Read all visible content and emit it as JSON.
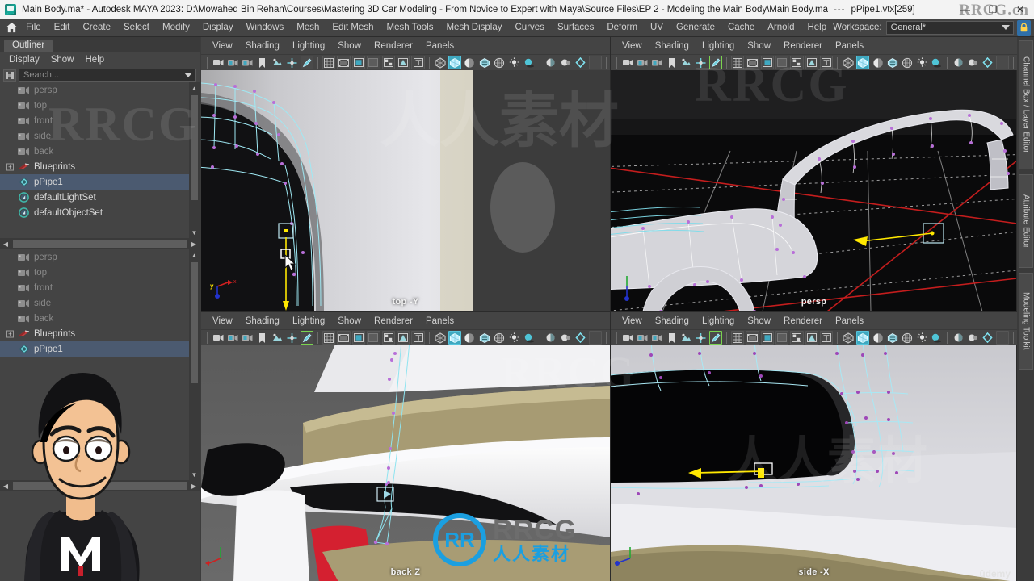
{
  "titlebar": {
    "app_icon": "maya-file-icon",
    "title": "Main Body.ma* - Autodesk MAYA 2023: D:\\Mowahed Bin Rehan\\Courses\\Mastering 3D Car Modeling - From Novice to Expert with Maya\\Source Files\\EP 2 - Modeling the Main Body\\Main Body.ma",
    "separator": "---",
    "selection": "pPipe1.vtx[259]",
    "minimize": "—",
    "maximize": "❐",
    "close": "✕"
  },
  "menubar": {
    "home_icon": "home-icon",
    "items": [
      "File",
      "Edit",
      "Create",
      "Select",
      "Modify",
      "Display",
      "Windows",
      "Mesh",
      "Edit Mesh",
      "Mesh Tools",
      "Mesh Display",
      "Curves",
      "Surfaces",
      "Deform",
      "UV",
      "Generate",
      "Cache",
      "Arnold",
      "Help"
    ],
    "workspace_label": "Workspace:",
    "workspace_value": "General*",
    "lock_icon": "lock-icon"
  },
  "outliner": {
    "tab_label": "Outliner",
    "menus": [
      "Display",
      "Show",
      "Help"
    ],
    "search_icon": "outliner-filter-icon",
    "search_placeholder": "Search...",
    "top_items": [
      {
        "label": "persp",
        "icon": "camera-icon",
        "dim": true,
        "selected": false,
        "expandable": false
      },
      {
        "label": "top",
        "icon": "camera-icon",
        "dim": true,
        "selected": false,
        "expandable": false
      },
      {
        "label": "front",
        "icon": "camera-icon",
        "dim": true,
        "selected": false,
        "expandable": false
      },
      {
        "label": "side",
        "icon": "camera-icon",
        "dim": true,
        "selected": false,
        "expandable": false
      },
      {
        "label": "back",
        "icon": "camera-icon",
        "dim": true,
        "selected": false,
        "expandable": false
      },
      {
        "label": "Blueprints",
        "icon": "group-icon",
        "dim": false,
        "selected": false,
        "expandable": true
      },
      {
        "label": "pPipe1",
        "icon": "mesh-icon",
        "dim": false,
        "selected": true,
        "expandable": false
      },
      {
        "label": "defaultLightSet",
        "icon": "set-icon",
        "dim": false,
        "selected": false,
        "expandable": false
      },
      {
        "label": "defaultObjectSet",
        "icon": "set-icon",
        "dim": false,
        "selected": false,
        "expandable": false
      }
    ],
    "bottom_items": [
      {
        "label": "persp",
        "icon": "camera-icon",
        "dim": true,
        "selected": false,
        "expandable": false
      },
      {
        "label": "top",
        "icon": "camera-icon",
        "dim": true,
        "selected": false,
        "expandable": false
      },
      {
        "label": "front",
        "icon": "camera-icon",
        "dim": true,
        "selected": false,
        "expandable": false
      },
      {
        "label": "side",
        "icon": "camera-icon",
        "dim": true,
        "selected": false,
        "expandable": false
      },
      {
        "label": "back",
        "icon": "camera-icon",
        "dim": true,
        "selected": false,
        "expandable": false
      },
      {
        "label": "Blueprints",
        "icon": "group-icon",
        "dim": false,
        "selected": false,
        "expandable": true
      },
      {
        "label": "pPipe1",
        "icon": "mesh-icon",
        "dim": false,
        "selected": true,
        "expandable": false
      }
    ]
  },
  "viewport_menus": [
    "View",
    "Shading",
    "Lighting",
    "Show",
    "Renderer",
    "Panels"
  ],
  "viewport_toolbar_icons": [
    "select-camera-icon",
    "camera-attributes-icon",
    "bookmarks-icon",
    "image-plane-icon",
    "paint-effects-icon",
    "snap-icon",
    "toggle-gizmo-icon",
    "grid-icon",
    "film-gate-icon",
    "resolution-gate-icon",
    "gate-mask-icon",
    "exposure-icon",
    "xray-icon",
    "xray-joints-icon",
    "wireframe-icon",
    "smooth-shade-icon",
    "shaded-wireframe-icon",
    "textured-icon",
    "lighting-icon",
    "shadows-icon",
    "screen-space-ao-icon",
    "motion-blur-icon",
    "multisample-icon",
    "depth-peel-icon"
  ],
  "viewports": [
    {
      "id": "vp-top",
      "label": "top -Y",
      "camera": "top"
    },
    {
      "id": "vp-persp",
      "label": "persp",
      "camera": "persp"
    },
    {
      "id": "vp-back",
      "label": "back Z",
      "camera": "back"
    },
    {
      "id": "vp-side",
      "label": "side -X",
      "camera": "side"
    }
  ],
  "right_rail_tabs": [
    "Channel Box / Layer Editor",
    "Attribute Editor",
    "Modeling Toolkit"
  ],
  "overlays": {
    "logo_mark": "RR",
    "logo_line1": "RRCG",
    "logo_line2": "人人素材",
    "corner_watermark": "RRCG.cn",
    "udemy": "ûdemy",
    "watermark_text": "RRCG",
    "watermark_cn": "人人素材",
    "avatar": "presenter-avatar"
  },
  "colors": {
    "accent_blue": "#3fa8c0",
    "selection_blue": "#4b5a70",
    "wire_cyan": "#8fe4f0",
    "vertex_magenta": "#c060d0",
    "manipulator_yellow": "#ffe800",
    "axis_x_red": "#d02020",
    "logo_blue": "#1b9fe0",
    "panel_gray": "#444444",
    "window_title_bg": "#f3f3f3"
  }
}
